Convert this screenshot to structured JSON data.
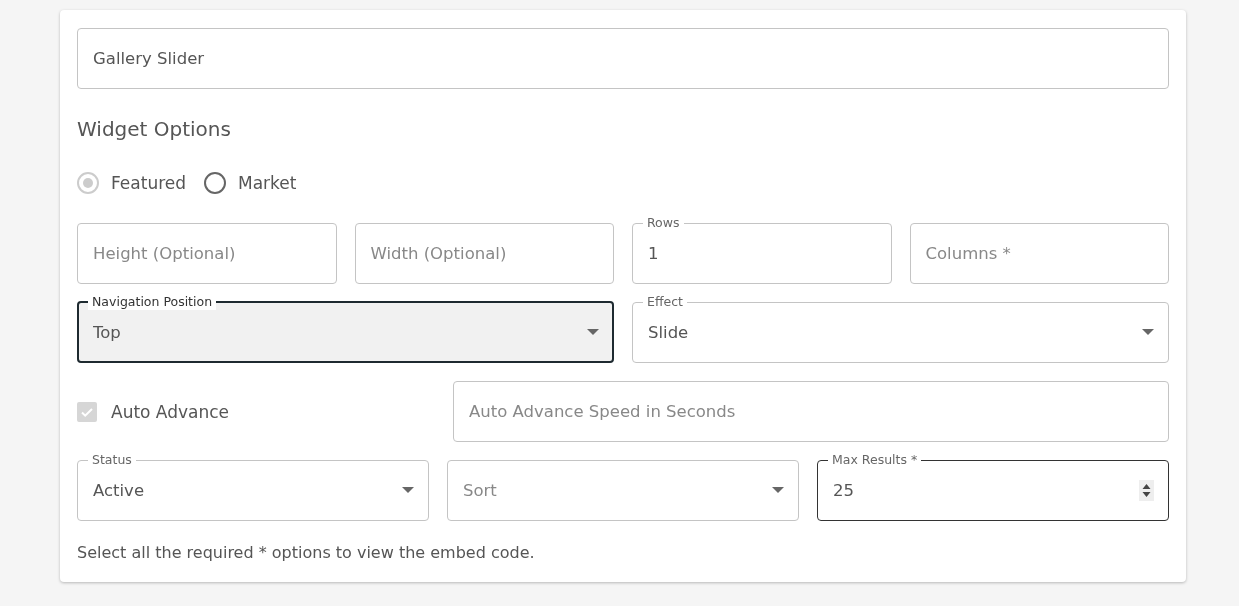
{
  "name_field": {
    "value": "Gallery Slider"
  },
  "section_title": "Widget Options",
  "radios": [
    {
      "label": "Featured",
      "selected": true,
      "disabled": true
    },
    {
      "label": "Market",
      "selected": false,
      "disabled": false
    }
  ],
  "rows": [
    {
      "items": [
        {
          "kind": "text",
          "placeholder": "Height (Optional)",
          "focused": false
        },
        {
          "kind": "text",
          "placeholder": "Width (Optional)",
          "focused": false
        },
        {
          "kind": "text",
          "label": "Rows",
          "value": "1",
          "focused": false
        },
        {
          "kind": "text",
          "placeholder": "Columns *",
          "focused": false
        }
      ]
    },
    {
      "items": [
        {
          "kind": "select",
          "label": "Navigation Position",
          "value": "Top",
          "focused": true
        },
        {
          "kind": "select",
          "label": "Effect",
          "value": "Slide",
          "focused": false
        }
      ]
    },
    {
      "items": [
        {
          "kind": "checkbox",
          "label": "Auto Advance",
          "checked": true,
          "disabled": true
        },
        {
          "kind": "text",
          "placeholder": "Auto Advance Speed in Seconds",
          "focused": false
        }
      ]
    },
    {
      "items": [
        {
          "kind": "select",
          "label": "Status",
          "value": "Active",
          "focused": false
        },
        {
          "kind": "select",
          "placeholder": "Sort",
          "focused": false
        },
        {
          "kind": "number",
          "label": "Max Results *",
          "value": "25",
          "focused": false,
          "hovered": true
        }
      ]
    }
  ],
  "note": "Select all the required * options to view the embed code."
}
